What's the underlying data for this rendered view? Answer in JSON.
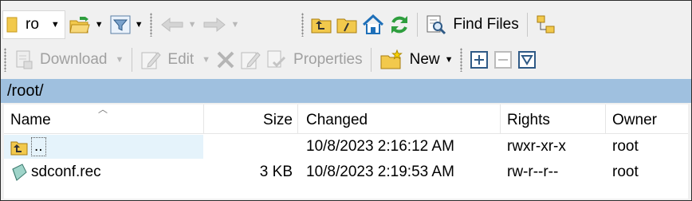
{
  "toolbar1": {
    "location_text": "ro",
    "find_files_label": "Find Files"
  },
  "toolbar2": {
    "download_label": "Download",
    "edit_label": "Edit",
    "properties_label": "Properties",
    "new_label": "New"
  },
  "path": "/root/",
  "columns": {
    "name": "Name",
    "size": "Size",
    "changed": "Changed",
    "rights": "Rights",
    "owner": "Owner"
  },
  "rows": [
    {
      "name": "..",
      "size": "",
      "changed": "10/8/2023 2:16:12 AM",
      "rights": "rwxr-xr-x",
      "owner": "root",
      "icon": "parent-directory-icon"
    },
    {
      "name": "sdconf.rec",
      "size": "3 KB",
      "changed": "10/8/2023 2:19:53 AM",
      "rights": "rw-r--r--",
      "owner": "root",
      "icon": "file-icon"
    }
  ],
  "colors": {
    "path_bar": "#9fc0df",
    "selection": "#e5f3fb",
    "accent_green": "#2e9e3e",
    "accent_blue": "#1e6fb8"
  }
}
